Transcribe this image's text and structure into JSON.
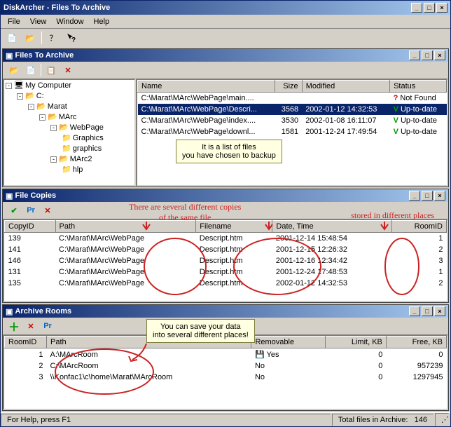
{
  "app_title": "DiskArcher - Files To Archive",
  "menu": {
    "file": "File",
    "view": "View",
    "window": "Window",
    "help": "Help"
  },
  "statusbar": {
    "help": "For Help, press F1",
    "total_label": "Total files in Archive:",
    "total_count": "146"
  },
  "window_files": {
    "title": "Files To Archive",
    "columns": {
      "name": "Name",
      "size": "Size",
      "modified": "Modified",
      "status": "Status"
    },
    "tree": {
      "root": "My Computer",
      "drive": "C:",
      "n1": "Marat",
      "n2": "MArc",
      "n3": "WebPage",
      "n3a": "Graphics",
      "n3b": "graphics",
      "n4": "MArc2",
      "n4a": "hlp"
    },
    "rows": [
      {
        "name": "C:\\Marat\\MArc\\WebPage\\main....",
        "size": "",
        "modified": "",
        "status": "Not Found",
        "icon": "?"
      },
      {
        "name": "C:\\Marat\\MArc\\WebPage\\Descri...",
        "size": "3568",
        "modified": "2002-01-12 14:32:53",
        "status": "Up-to-date",
        "icon": "V",
        "selected": true
      },
      {
        "name": "C:\\Marat\\MArc\\WebPage\\index....",
        "size": "3530",
        "modified": "2002-01-08 16:11:07",
        "status": "Up-to-date",
        "icon": "V"
      },
      {
        "name": "C:\\Marat\\MArc\\WebPage\\downl...",
        "size": "1581",
        "modified": "2001-12-24 17:49:54",
        "status": "Up-to-date",
        "icon": "V"
      }
    ],
    "note": "It is a list of files\nyou have chosen to backup"
  },
  "window_copies": {
    "title": "File Copies",
    "columns": {
      "id": "CopyID",
      "path": "Path",
      "filename": "Filename",
      "datetime": "Date, Time",
      "room": "RoomID"
    },
    "rows": [
      {
        "id": "139",
        "path": "C:\\Marat\\MArc\\WebPage",
        "filename": "Descript.htm",
        "datetime": "2001-12-14 15:48:54",
        "room": "1"
      },
      {
        "id": "141",
        "path": "C:\\Marat\\MArc\\WebPage",
        "filename": "Descript.htm",
        "datetime": "2001-12-15 12:26:32",
        "room": "2"
      },
      {
        "id": "146",
        "path": "C:\\Marat\\MArc\\WebPage",
        "filename": "Descript.htm",
        "datetime": "2001-12-16 12:34:42",
        "room": "3"
      },
      {
        "id": "131",
        "path": "C:\\Marat\\MArc\\WebPage",
        "filename": "Descript.htm",
        "datetime": "2001-12-24 17:48:53",
        "room": "1"
      },
      {
        "id": "135",
        "path": "C:\\Marat\\MArc\\WebPage",
        "filename": "Descript.htm",
        "datetime": "2002-01-12 14:32:53",
        "room": "2"
      }
    ],
    "ann_left": "There are several different copies\nof the same file",
    "ann_right": "stored in different places"
  },
  "window_rooms": {
    "title": "Archive Rooms",
    "columns": {
      "id": "RoomID",
      "path": "Path",
      "removable": "Removable",
      "limit": "Limit, KB",
      "free": "Free, KB"
    },
    "rows": [
      {
        "id": "1",
        "path": "A:\\MArcRoom",
        "removable": "Yes",
        "limit": "0",
        "free": "0",
        "disk": true
      },
      {
        "id": "2",
        "path": "C:\\MArcRoom",
        "removable": "No",
        "limit": "0",
        "free": "957239"
      },
      {
        "id": "3",
        "path": "\\\\Konfac1\\c\\home\\Marat\\MArcRoom",
        "removable": "No",
        "limit": "0",
        "free": "1297945"
      }
    ],
    "note": "You can save your data\ninto several different places!"
  }
}
